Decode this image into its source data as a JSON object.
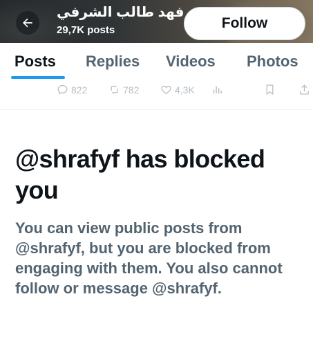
{
  "header": {
    "profile_name": "فهد طالب الشرفي",
    "post_count": "29,7K posts",
    "follow_label": "Follow"
  },
  "tabs": [
    {
      "label": "Posts",
      "active": true
    },
    {
      "label": "Replies",
      "active": false
    },
    {
      "label": "Videos",
      "active": false
    },
    {
      "label": "Photos",
      "active": false
    }
  ],
  "actions": {
    "replies": "822",
    "reposts": "782",
    "likes": "4,3K"
  },
  "blocked": {
    "title": "@shrafyf has blocked you",
    "message": "You can view public posts from @shrafyf, but you are blocked from engaging with them. You also cannot follow or message @shrafyf."
  },
  "colors": {
    "accent": "#1d9bf0",
    "text_primary": "#0f1419",
    "text_secondary": "#536471"
  }
}
